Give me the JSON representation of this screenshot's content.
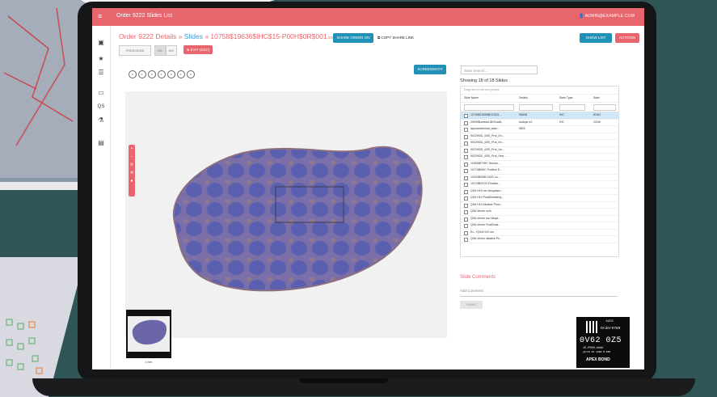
{
  "app": {
    "title_main": "Order 9222 Slides",
    "title_sub": "List",
    "user": "ADMIN@EXAMPLE.COM"
  },
  "breadcrumb": {
    "order": "Order 9222 Details",
    "sep1": " » ",
    "slides": "Slides",
    "sep2": " » ",
    "file": "10758$19636$IHC$15-P00H$0R$001",
    "ext": ".svs"
  },
  "toolbar": {
    "share_order": "SHARE ORDER ON",
    "copy_link": "COPY SHARE LINK",
    "show_list": "SHOW LIST",
    "actions": "ACTIONS",
    "view_mode": "FREEMODE",
    "toggle_a": "HE",
    "toggle_b": "IHC",
    "exit_label": "EXIT (ESC)",
    "screenshot": "SCREENSHOT"
  },
  "icons": [
    "grid-icon",
    "star-icon",
    "list-icon",
    "image-icon",
    "qs-icon",
    "microscope-icon",
    "comment-icon"
  ],
  "zoom_controls": [
    "+",
    "−",
    "⟳",
    "⟲",
    "●"
  ],
  "slides_panel": {
    "search_placeholder": "Slide Search...",
    "showing": "Showing 18 of 18 Slides",
    "group_hint": "Drag here to set row groups",
    "columns": [
      "Slide Name",
      "Details",
      "Stain Type",
      "Stain"
    ],
    "rows": [
      {
        "name": "10758$19636$IHC$15...",
        "details": "9880B",
        "type": "IHC",
        "stain": "8C6H",
        "selected": true
      },
      {
        "name": "23999$unresol.$IHCaa$...",
        "details": "Isotope #1",
        "type": "IHC",
        "stain": "CD3e",
        "selected": false
      },
      {
        "name": "aqumarafurmat_stain...",
        "details": "9820",
        "type": "",
        "stain": "",
        "selected": false
      },
      {
        "name": "90229031_6SS_Prot_En...",
        "details": "",
        "type": "",
        "stain": "",
        "selected": false
      },
      {
        "name": "90229031_6SS_Prot_En...",
        "details": "",
        "type": "",
        "stain": "",
        "selected": false
      },
      {
        "name": "90229031_6SS_Prot_Un...",
        "details": "",
        "type": "",
        "stain": "",
        "selected": false
      },
      {
        "name": "90229031_6SS_Prot_Hea...",
        "details": "",
        "type": "",
        "stain": "",
        "selected": false
      },
      {
        "name": "11852$0YIHC Human...",
        "details": "",
        "type": "",
        "stain": "",
        "selected": false
      },
      {
        "name": "10719$0IHC Positive E...",
        "details": "",
        "type": "",
        "stain": "",
        "selected": false
      },
      {
        "name": "10324$0489-Cd31 cu...",
        "details": "",
        "type": "",
        "stain": "",
        "selected": false
      },
      {
        "name": "10719$0YCD Positive...",
        "details": "",
        "type": "",
        "stain": "",
        "selected": false
      },
      {
        "name": "QSA H19 ron Neoplasm...",
        "details": "",
        "type": "",
        "stain": "",
        "selected": false
      },
      {
        "name": "QSA H19 PostDmaldehy...",
        "details": "",
        "type": "",
        "stain": "",
        "selected": false
      },
      {
        "name": "QSA H19 Alcaline Phos...",
        "details": "",
        "type": "",
        "stain": "",
        "selected": false
      },
      {
        "name": "QSA Vector som",
        "details": "",
        "type": "",
        "stain": "",
        "selected": false
      },
      {
        "name": "QSA Vector ron Neopl...",
        "details": "",
        "type": "",
        "stain": "",
        "selected": false
      },
      {
        "name": "QSA Vector PostDmal...",
        "details": "",
        "type": "",
        "stain": "",
        "selected": false
      },
      {
        "name": "Ex -+QSA H19 ron",
        "details": "",
        "type": "",
        "stain": "",
        "selected": false
      },
      {
        "name": "QSA Vector alkaline Ph...",
        "details": "",
        "type": "",
        "stain": "",
        "selected": false
      }
    ]
  },
  "comments": {
    "heading": "Slide Comments",
    "placeholder": "Add Comment",
    "submit": "SUBMIT"
  },
  "thumbnail": {
    "scale": "1 mm"
  },
  "slide_label": {
    "line1": "19C0",
    "line2": "Order9789",
    "big": "0V62 0Z5",
    "line3": "15-P00H-####",
    "line4": "g6/18 R1 12B0 M.##R",
    "brand": "APEX BOND"
  },
  "colors": {
    "accent": "#e8656e",
    "teal": "#2191b8",
    "background": "#2f5557"
  }
}
